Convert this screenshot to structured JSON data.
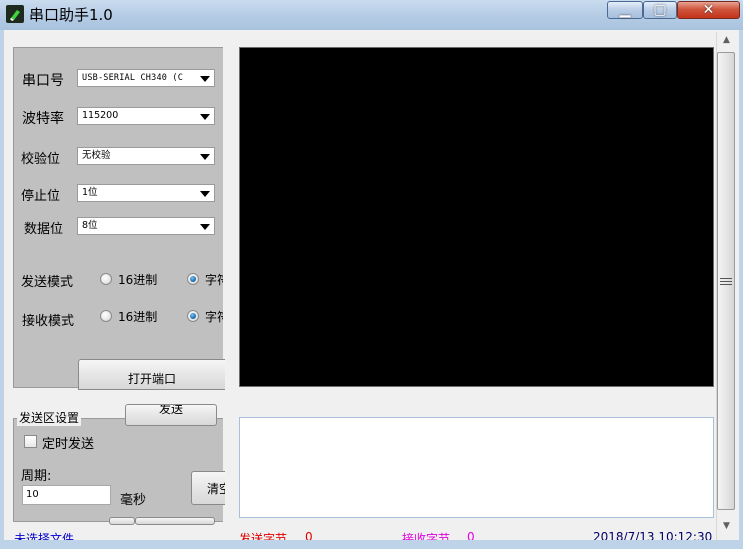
{
  "window": {
    "title": "串口助手1.0",
    "minimize_glyph": "▁",
    "maximize_glyph": "▢",
    "close_glyph": "✕"
  },
  "serial": {
    "port_label": "串口号",
    "port_value": "USB-SERIAL CH340 (C",
    "baud_label": "波特率",
    "baud_value": "115200",
    "parity_label": "校验位",
    "parity_value": "无校验",
    "stop_label": "停止位",
    "stop_value": "1位",
    "data_label": "数据位",
    "data_value": "8位"
  },
  "modes": {
    "send_mode_label": "发送模式",
    "recv_mode_label": "接收模式",
    "hex_option": "16进制",
    "char_option": "字符"
  },
  "buttons": {
    "open_port": "打开端口",
    "send": "发送",
    "clear": "清空"
  },
  "send_settings": {
    "caption": "发送区设置",
    "timed_send": "定时发送",
    "period_label": "周期:",
    "period_value": "10",
    "unit": "毫秒"
  },
  "status": {
    "file": "未选择文件",
    "sent_label": "发送字节",
    "sent_value": "0",
    "recv_label": "接收字节",
    "recv_value": "0",
    "datetime": "2018/7/13 10:12:30"
  },
  "colors": {
    "status_file": "#0000cc",
    "status_sent": "#e00000",
    "status_recv": "#e000e0",
    "status_datetime": "#000066"
  }
}
